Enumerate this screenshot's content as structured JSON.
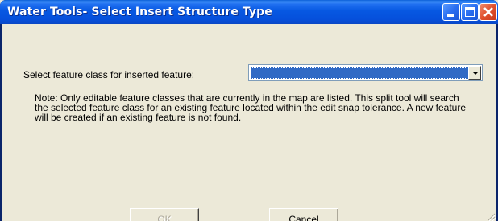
{
  "window": {
    "title": "Water Tools- Select Insert Structure Type"
  },
  "titlebar_icons": [
    "minimize-icon",
    "maximize-icon",
    "close-icon"
  ],
  "form": {
    "select_label": "Select feature class for inserted feature:",
    "feature_class_value": "",
    "note": "Note:  Only editable feature classes that are currently in the map are listed.  This split tool will search the selected feature class for an existing feature located within the edit snap tolerance.  A new feature will be created if an existing feature is not found."
  },
  "buttons": {
    "ok_label": "OK",
    "cancel_label": "Cancel"
  },
  "colors": {
    "titlebar": "#0758e2",
    "selection": "#316ac5",
    "dialog_face": "#ece9d8",
    "disabled_text": "#aca899"
  }
}
